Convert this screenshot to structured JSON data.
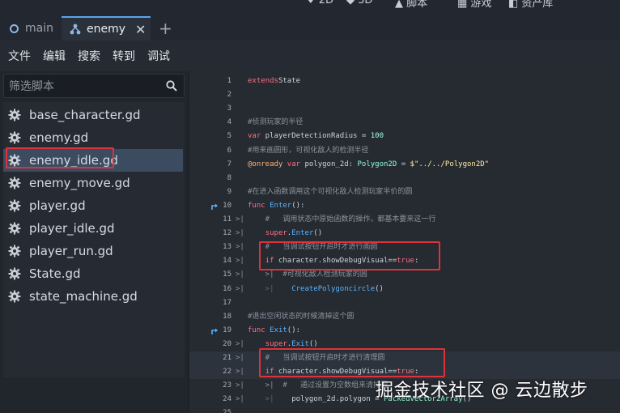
{
  "top_strip": {
    "items": [
      "♦ 2D",
      "◆ 3D",
      "▲ 脚本",
      "▦ 游戏",
      "◧ 资产库"
    ]
  },
  "tabs": [
    {
      "label": "main",
      "active": false
    },
    {
      "label": "enemy",
      "active": true
    }
  ],
  "tab_close": "✕",
  "tab_add": "+",
  "menu": [
    "文件",
    "编辑",
    "搜索",
    "转到",
    "调试"
  ],
  "filter": {
    "placeholder": "筛选脚本"
  },
  "files": [
    {
      "name": "base_character.gd"
    },
    {
      "name": "enemy.gd"
    },
    {
      "name": "enemy_idle.gd",
      "selected": true
    },
    {
      "name": "enemy_move.gd"
    },
    {
      "name": "player.gd"
    },
    {
      "name": "player_idle.gd"
    },
    {
      "name": "player_run.gd"
    },
    {
      "name": "State.gd"
    },
    {
      "name": "state_machine.gd"
    }
  ],
  "code": {
    "lines": [
      {
        "n": "1",
        "parts": [
          [
            "kw",
            "extends"
          ],
          [
            "",
            "State"
          ]
        ]
      },
      {
        "n": "2",
        "parts": []
      },
      {
        "n": "3",
        "parts": []
      },
      {
        "n": "4",
        "parts": [
          [
            "cm",
            "#侦测玩家的半径"
          ]
        ]
      },
      {
        "n": "5",
        "parts": [
          [
            "kw",
            "var"
          ],
          [
            "",
            " playerDetectionRadius = "
          ],
          [
            "num",
            "100"
          ]
        ]
      },
      {
        "n": "6",
        "parts": [
          [
            "cm",
            "#用来画圆形，可视化敌人的检测半径"
          ]
        ]
      },
      {
        "n": "7",
        "parts": [
          [
            "ann",
            "@onready"
          ],
          [
            "",
            " "
          ],
          [
            "kw",
            "var"
          ],
          [
            "",
            " polygon_2d: "
          ],
          [
            "typ",
            "Polygon2D"
          ],
          [
            "",
            " = "
          ],
          [
            "str",
            "$\"../../Polygon2D\""
          ]
        ]
      },
      {
        "n": "8",
        "parts": []
      },
      {
        "n": "9",
        "parts": [
          [
            "cm",
            "#在进入函数调用这个可视化敌人检测玩家半价的圆"
          ]
        ]
      },
      {
        "n": "10",
        "parts": [
          [
            "kw",
            "func"
          ],
          [
            "",
            " "
          ],
          [
            "fn",
            "Enter"
          ],
          [
            "",
            "():"
          ]
        ]
      },
      {
        "n": "11",
        "parts": [
          [
            "cm",
            "    #   调用状态中原始函数的操作，都基本要来这一行"
          ]
        ]
      },
      {
        "n": "12",
        "parts": [
          [
            "ind",
            "    "
          ],
          [
            "kw",
            "super"
          ],
          [
            "",
            "."
          ],
          [
            "fn",
            "Enter"
          ],
          [
            "",
            "()"
          ]
        ]
      },
      {
        "n": "13",
        "parts": [
          [
            "cm",
            "    #   当调试按钮开启时才进行画圆"
          ]
        ]
      },
      {
        "n": "14",
        "parts": [
          [
            "ind",
            "    "
          ],
          [
            "kw",
            "if"
          ],
          [
            "",
            " character.showDebugVisual=="
          ],
          [
            "kw",
            "true"
          ],
          [
            "",
            ":"
          ]
        ]
      },
      {
        "n": "15",
        "parts": [
          [
            "cm",
            "    >|  #可视化敌人检测玩家的圆"
          ]
        ]
      },
      {
        "n": "16",
        "parts": [
          [
            "ind",
            "    >|    "
          ],
          [
            "fn",
            "CreatePolygoncircle"
          ],
          [
            "",
            "()"
          ]
        ]
      },
      {
        "n": "17",
        "parts": []
      },
      {
        "n": "18",
        "parts": [
          [
            "cm",
            "#退出空闲状态的时候清掉这个圆"
          ]
        ]
      },
      {
        "n": "19",
        "parts": [
          [
            "kw",
            "func"
          ],
          [
            "",
            " "
          ],
          [
            "fn",
            "Exit"
          ],
          [
            "",
            "():"
          ]
        ]
      },
      {
        "n": "20",
        "parts": [
          [
            "ind",
            "    "
          ],
          [
            "kw",
            "super"
          ],
          [
            "",
            "."
          ],
          [
            "fn",
            "Exit"
          ],
          [
            "",
            "()"
          ]
        ]
      },
      {
        "n": "21",
        "parts": [
          [
            "cm",
            "    #   当调试按钮开启时才进行清理圆"
          ]
        ]
      },
      {
        "n": "22",
        "parts": [
          [
            "ind",
            "    "
          ],
          [
            "kw",
            "if"
          ],
          [
            "",
            " character.showDebugVisual=="
          ],
          [
            "kw",
            "true"
          ],
          [
            "",
            ":"
          ]
        ]
      },
      {
        "n": "23",
        "parts": [
          [
            "cm",
            "    >|  #   通过设置为空数组来清掉圆"
          ]
        ]
      },
      {
        "n": "24",
        "parts": [
          [
            "ind",
            "    >|    "
          ],
          [
            "",
            "polygon_2d.polygon = "
          ],
          [
            "typ",
            "PackedVector2Array"
          ],
          [
            "",
            "()"
          ]
        ]
      },
      {
        "n": "25",
        "parts": []
      }
    ]
  },
  "watermark": "掘金技术社区 @ 云边散步",
  "colors": {
    "accent": "#57a6ee",
    "highlight_box": "#e0323a",
    "selected_row": "#3c4c60"
  }
}
